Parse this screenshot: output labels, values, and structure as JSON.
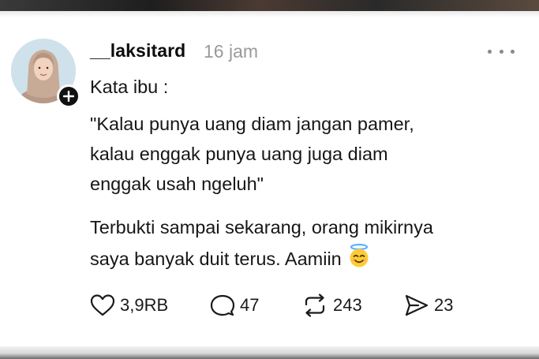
{
  "post": {
    "username": "__laksitard",
    "timestamp": "16 jam",
    "lines": [
      "Kata ibu :",
      "\"Kalau punya uang diam jangan pamer,",
      "kalau enggak punya uang juga diam",
      "enggak usah ngeluh\"",
      "Terbukti sampai sekarang, orang mikirnya",
      "saya banyak duit terus. Aamiin"
    ],
    "emoji": "smiling-face-with-halo"
  },
  "actions": {
    "likes": "3,9RB",
    "replies": "47",
    "reposts": "243",
    "shares": "23"
  },
  "colors": {
    "text": "#111111",
    "muted": "#9a9a9a",
    "background": "#ffffff"
  }
}
